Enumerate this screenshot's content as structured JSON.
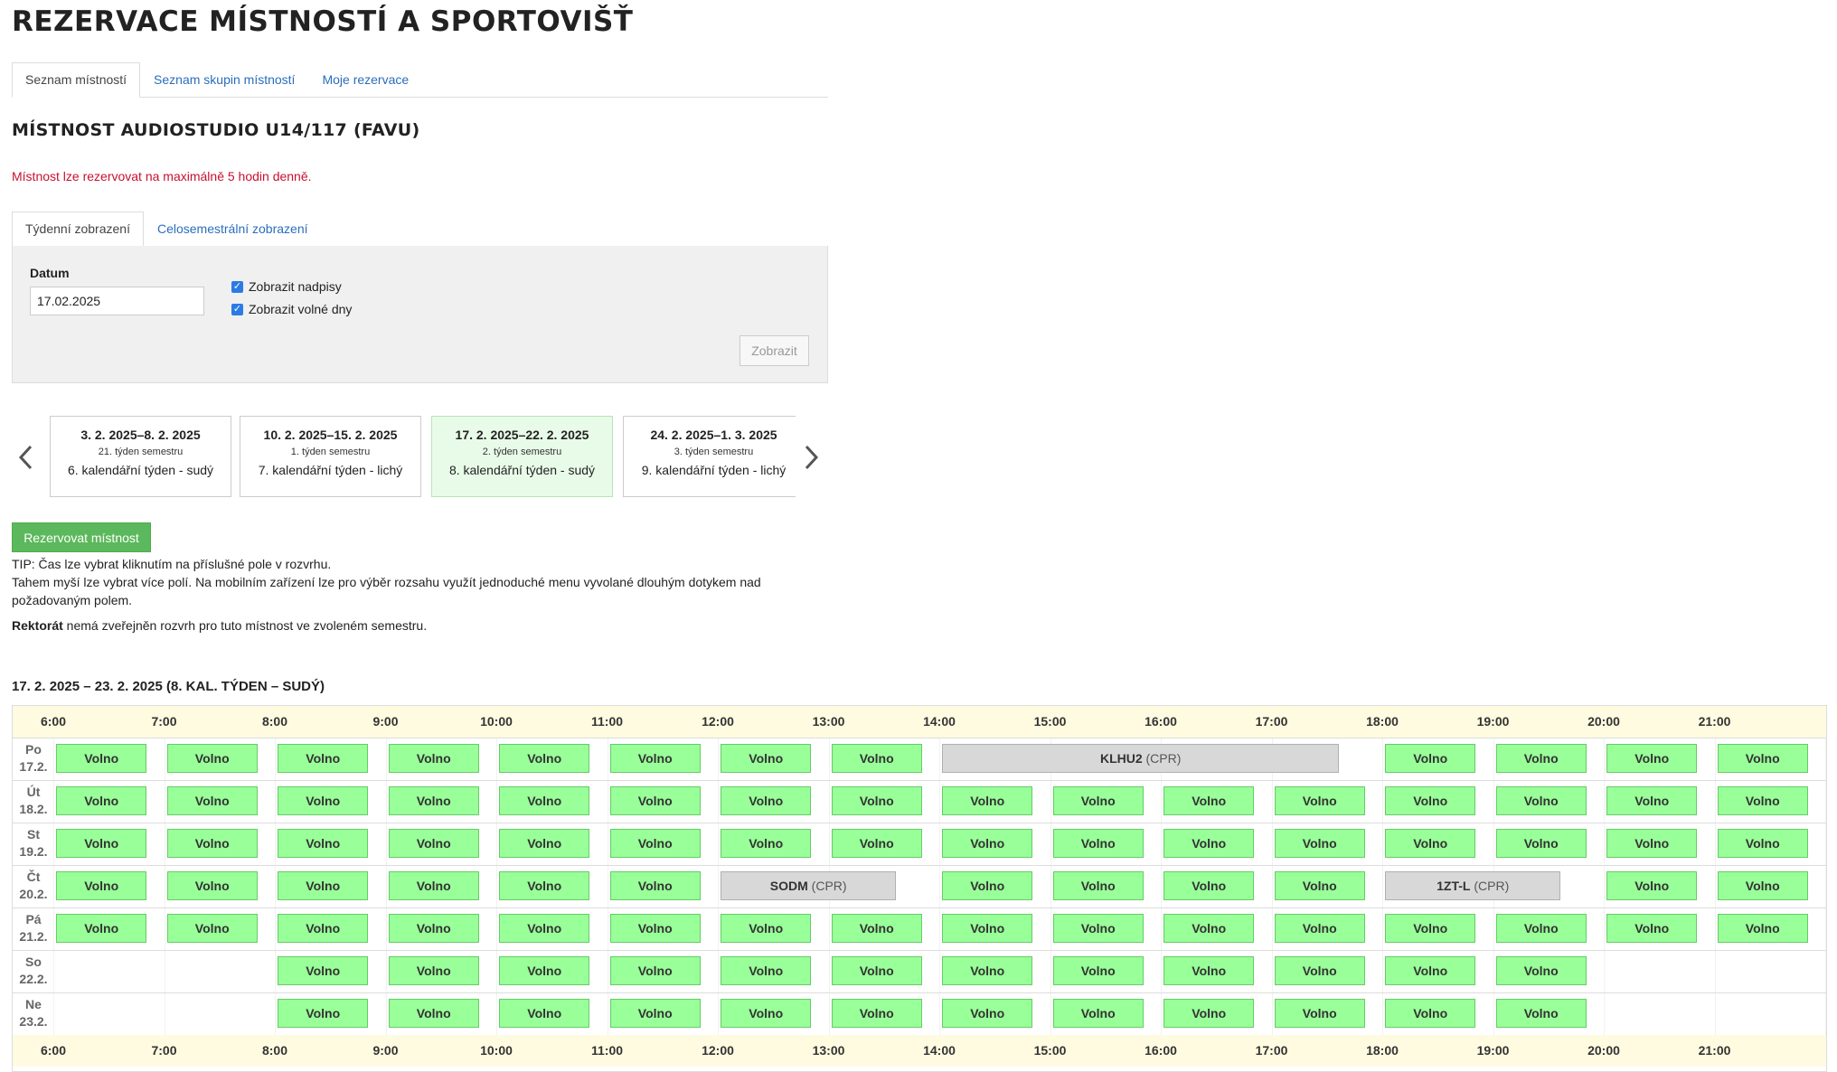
{
  "page": {
    "title": "REZERVACE MÍSTNOSTÍ A SPORTOVIŠŤ"
  },
  "main_tabs": [
    {
      "label": "Seznam místností",
      "active": true
    },
    {
      "label": "Seznam skupin místností",
      "active": false
    },
    {
      "label": "Moje rezervace",
      "active": false
    }
  ],
  "room": {
    "title": "MÍSTNOST AUDIOSTUDIO U14/117 (FAVU)",
    "note": "Místnost lze rezervovat na maximálně 5 hodin denně."
  },
  "view_tabs": [
    {
      "label": "Týdenní zobrazení",
      "active": true
    },
    {
      "label": "Celosemestrální zobrazení",
      "active": false
    }
  ],
  "filter": {
    "date_label": "Datum",
    "date_value": "17.02.2025",
    "show_labels": "Zobrazit nadpisy",
    "show_free_days": "Zobrazit volné dny",
    "submit_label": "Zobrazit"
  },
  "weeks": [
    {
      "range": "3. 2. 2025–8. 2. 2025",
      "semester": "21. týden semestru",
      "calendar": "6. kalendářní týden - sudý",
      "current": false
    },
    {
      "range": "10. 2. 2025–15. 2. 2025",
      "semester": "1. týden semestru",
      "calendar": "7. kalendářní týden - lichý",
      "current": false
    },
    {
      "range": "17. 2. 2025–22. 2. 2025",
      "semester": "2. týden semestru",
      "calendar": "8. kalendářní týden - sudý",
      "current": true
    },
    {
      "range": "24. 2. 2025–1. 3. 2025",
      "semester": "3. týden semestru",
      "calendar": "9. kalendářní týden - lichý",
      "current": false
    }
  ],
  "actions": {
    "reserve_label": "Rezervovat místnost",
    "tip_line1": "TIP: Čas lze vybrat kliknutím na příslušné pole v rozvrhu.",
    "tip_line2": "Tahem myší lze vybrat více polí. Na mobilním zařízení lze pro výběr rozsahu využít jednoduché menu vyvolané dlouhým dotykem nad požadovaným polem.",
    "rektorat_bold": "Rektorát",
    "rektorat_text": " nemá zveřejněn rozvrh pro tuto místnost ve zvoleném semestru."
  },
  "schedule": {
    "heading": "17. 2. 2025 – 23. 2. 2025 (8. KAL. TÝDEN – SUDÝ)",
    "hours": [
      "6:00",
      "7:00",
      "8:00",
      "9:00",
      "10:00",
      "11:00",
      "12:00",
      "13:00",
      "14:00",
      "15:00",
      "16:00",
      "17:00",
      "18:00",
      "19:00",
      "20:00",
      "21:00"
    ],
    "free_label": "Volno",
    "days": [
      {
        "abbr": "Po",
        "date": "17.2.",
        "free": [
          6,
          7,
          8,
          9,
          10,
          11,
          12,
          13,
          18,
          19,
          20,
          21
        ],
        "booked": [
          {
            "code": "KLHU2",
            "type": "(CPR)",
            "start": 14,
            "end": 17.75
          }
        ]
      },
      {
        "abbr": "Út",
        "date": "18.2.",
        "free": [
          6,
          7,
          8,
          9,
          10,
          11,
          12,
          13,
          14,
          15,
          16,
          17,
          18,
          19,
          20,
          21
        ],
        "booked": []
      },
      {
        "abbr": "St",
        "date": "19.2.",
        "free": [
          6,
          7,
          8,
          9,
          10,
          11,
          12,
          13,
          14,
          15,
          16,
          17,
          18,
          19,
          20,
          21
        ],
        "booked": []
      },
      {
        "abbr": "Čt",
        "date": "20.2.",
        "free": [
          6,
          7,
          8,
          9,
          10,
          11,
          14,
          15,
          16,
          17,
          20,
          21
        ],
        "booked": [
          {
            "code": "SODM",
            "type": "(CPR)",
            "start": 12,
            "end": 13.75
          },
          {
            "code": "1ZT-L",
            "type": "(CPR)",
            "start": 18,
            "end": 19.75
          }
        ]
      },
      {
        "abbr": "Pá",
        "date": "21.2.",
        "free": [
          6,
          7,
          8,
          9,
          10,
          11,
          12,
          13,
          14,
          15,
          16,
          17,
          18,
          19,
          20,
          21
        ],
        "booked": []
      },
      {
        "abbr": "So",
        "date": "22.2.",
        "free": [
          8,
          9,
          10,
          11,
          12,
          13,
          14,
          15,
          16,
          17,
          18,
          19
        ],
        "booked": []
      },
      {
        "abbr": "Ne",
        "date": "23.2.",
        "free": [
          8,
          9,
          10,
          11,
          12,
          13,
          14,
          15,
          16,
          17,
          18,
          19
        ],
        "booked": []
      }
    ]
  },
  "colors": {
    "free": "#99ff99",
    "booked": "#d8d8d8",
    "link": "#2a6ebb",
    "warning": "#c8102e",
    "reserve_button": "#5cb85c",
    "hour_row": "#fffbe0"
  },
  "icons": [
    "chevron-left-icon",
    "chevron-right-icon",
    "checkbox-checked-icon"
  ]
}
